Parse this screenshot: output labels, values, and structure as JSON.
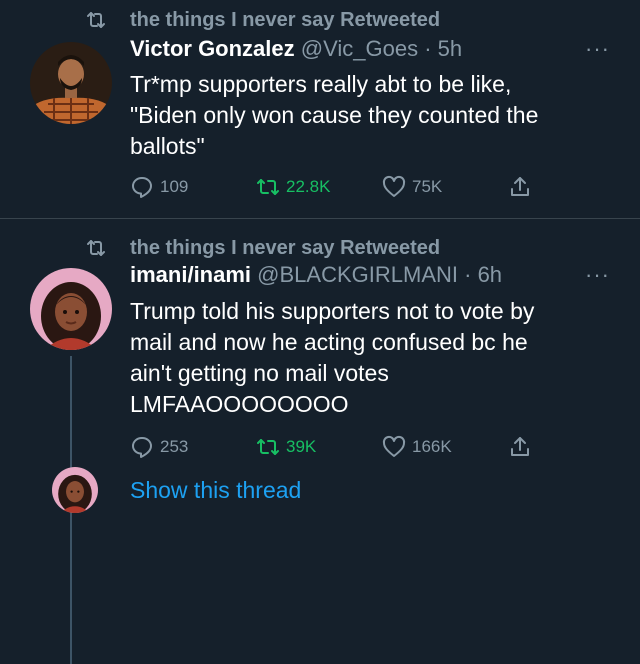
{
  "tweets": [
    {
      "retweet_label": "the things I never say Retweeted",
      "name": "Victor Gonzalez",
      "handle": "@Vic_Goes",
      "time": "· 5h",
      "text": "Tr*mp supporters really abt to be like,\n\"Biden only won cause they counted the\nballots\"",
      "replies": "109",
      "retweets": "22.8K",
      "likes": "75K"
    },
    {
      "retweet_label": "the things I never say Retweeted",
      "name": "imani/inami",
      "handle": "@BLACKGIRLMANI",
      "time": "· 6h",
      "text": "Trump told his supporters not to vote by\nmail and now he acting confused bc he\nain't getting no mail votes\nLMFAAOOOOOOOO",
      "replies": "253",
      "retweets": "39K",
      "likes": "166K",
      "show_thread": "Show this thread"
    }
  ],
  "icons": {
    "retweet": "retweet-icon",
    "reply": "reply-icon",
    "like": "heart-icon",
    "share": "share-icon",
    "more": "more-icon"
  },
  "colors": {
    "background": "#15202b",
    "muted": "#8899a6",
    "retweet_active": "#17bf63",
    "link": "#1da1f2"
  }
}
